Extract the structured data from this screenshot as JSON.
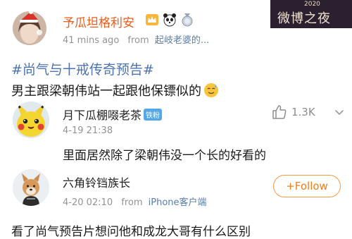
{
  "post": {
    "author": "予瓜坦格利安",
    "time": "41 mins ago",
    "from_label": "from",
    "source": "起岐老婆的...",
    "hashtag": "#尚气与十戒传奇预告#",
    "text": "男主跟梁朝伟站一起跟他保镖似的"
  },
  "watermark": {
    "year": "2020",
    "text": "微博之夜"
  },
  "comments": [
    {
      "author": "月下瓜棚啜老茶",
      "badge": "铁粉",
      "time": "4-19 21:38",
      "text": "里面居然除了梁朝伟没一个长的好看的",
      "likes": "1.3K"
    },
    {
      "author": "六角铃铛族长",
      "time": "4-20 02:10",
      "from_label": "from",
      "source": "iPhone客户端",
      "text": "看了尚气预告片想问他和成龙大哥有什么区别",
      "follow_label": "+Follow"
    }
  ],
  "colors": {
    "accent": "#ee5b1a",
    "link": "#4b73b0",
    "follow": "#f39b48"
  }
}
